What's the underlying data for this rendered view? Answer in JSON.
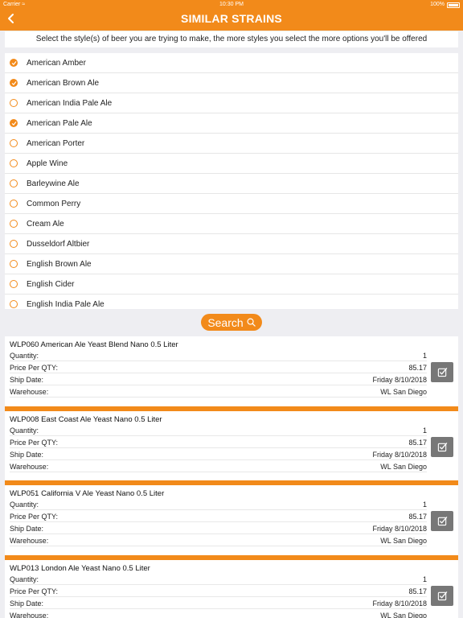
{
  "status": {
    "carrier": "Carrier",
    "time": "10:30 PM",
    "battery": "100%"
  },
  "nav": {
    "title": "SIMILAR STRAINS"
  },
  "instruction": "Select the style(s) of beer you are trying to make, the more styles you select the more options you'll be offered",
  "styles": [
    {
      "label": "American Amber",
      "checked": true
    },
    {
      "label": "American Brown Ale",
      "checked": true
    },
    {
      "label": "American India Pale Ale",
      "checked": false
    },
    {
      "label": "American Pale Ale",
      "checked": true
    },
    {
      "label": "American Porter",
      "checked": false
    },
    {
      "label": "Apple Wine",
      "checked": false
    },
    {
      "label": "Barleywine Ale",
      "checked": false
    },
    {
      "label": "Common Perry",
      "checked": false
    },
    {
      "label": "Cream Ale",
      "checked": false
    },
    {
      "label": "Dusseldorf Altbier",
      "checked": false
    },
    {
      "label": "English Brown Ale",
      "checked": false
    },
    {
      "label": "English Cider",
      "checked": false
    },
    {
      "label": "English India Pale Ale",
      "checked": false
    }
  ],
  "search": {
    "label": "Search"
  },
  "field_labels": {
    "quantity": "Quantity:",
    "price": "Price Per QTY:",
    "ship": "Ship Date:",
    "warehouse": "Warehouse:"
  },
  "results": [
    {
      "title": "WLP060 American Ale Yeast Blend Nano 0.5 Liter",
      "quantity": "1",
      "price": "85.17",
      "ship": "Friday 8/10/2018",
      "warehouse": "WL San Diego"
    },
    {
      "title": "WLP008 East Coast Ale Yeast Nano 0.5 Liter",
      "quantity": "1",
      "price": "85.17",
      "ship": "Friday 8/10/2018",
      "warehouse": "WL San Diego"
    },
    {
      "title": "WLP051 California V Ale Yeast Nano 0.5 Liter",
      "quantity": "1",
      "price": "85.17",
      "ship": "Friday 8/10/2018",
      "warehouse": "WL San Diego"
    },
    {
      "title": "WLP013 London Ale Yeast Nano 0.5 Liter",
      "quantity": "1",
      "price": "85.17",
      "ship": "Friday 8/10/2018",
      "warehouse": "WL San Diego"
    }
  ],
  "colors": {
    "accent": "#f28a1a",
    "button_gray": "#777777"
  }
}
